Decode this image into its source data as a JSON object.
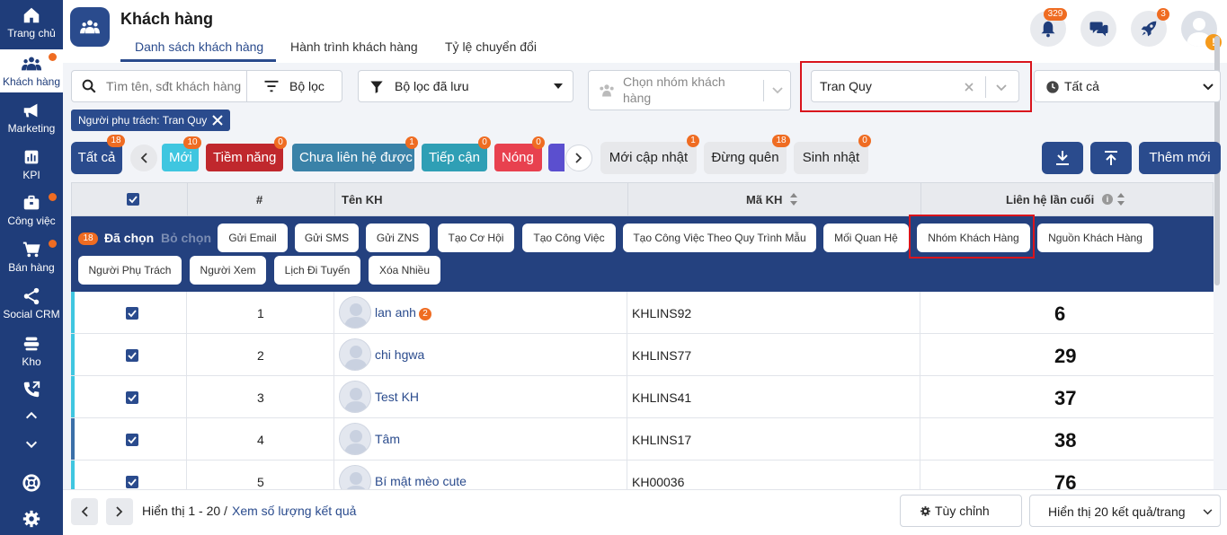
{
  "sidebar": {
    "items": [
      {
        "label": "Trang chủ",
        "icon": "home-icon"
      },
      {
        "label": "Khách hàng",
        "icon": "users-icon"
      },
      {
        "label": "Marketing",
        "icon": "megaphone-icon"
      },
      {
        "label": "KPI",
        "icon": "chart-icon"
      },
      {
        "label": "Công việc",
        "icon": "briefcase-icon"
      },
      {
        "label": "Bán hàng",
        "icon": "cart-icon"
      },
      {
        "label": "Social CRM",
        "icon": "share-icon"
      },
      {
        "label": "Kho",
        "icon": "warehouse-icon"
      }
    ]
  },
  "header": {
    "title": "Khách hàng",
    "tabs": [
      "Danh sách khách hàng",
      "Hành trình khách hàng",
      "Tỷ lệ chuyển đổi"
    ],
    "notif_count": "329",
    "rocket_count": "3"
  },
  "filters": {
    "search_placeholder": "Tìm tên, sđt khách hàng",
    "filter_label": "Bộ lọc",
    "saved_filter_label": "Bộ lọc đã lưu",
    "group_placeholder": "Chọn nhóm khách hàng",
    "owner_value": "Tran Quy",
    "time_value": "Tất cả",
    "active_chip": "Người phụ trách: Tran Quy"
  },
  "status_tags": {
    "all": {
      "label": "Tất cả",
      "count": "18"
    },
    "items": [
      {
        "label": "Mới",
        "count": "10",
        "color": "#3fc6e0"
      },
      {
        "label": "Tiềm năng",
        "count": "0",
        "color": "#c0282d"
      },
      {
        "label": "Chưa liên hệ được",
        "count": "1",
        "color": "#3a82a8"
      },
      {
        "label": "Tiếp cận",
        "count": "0",
        "color": "#2f9fb5"
      },
      {
        "label": "Nóng",
        "count": "0",
        "color": "#e8414f"
      }
    ],
    "extra": [
      {
        "label": "Mới cập nhật",
        "count": "1"
      },
      {
        "label": "Đừng quên",
        "count": "18"
      },
      {
        "label": "Sinh nhật",
        "count": "0"
      }
    ],
    "add_label": "Thêm mới"
  },
  "table": {
    "headers": {
      "index": "#",
      "name": "Tên KH",
      "code": "Mã KH",
      "last_contact": "Liên hệ lần cuối"
    },
    "selected_count": "18",
    "selected_label": "Đã chọn",
    "deselect_label": "Bỏ chọn",
    "actions": [
      "Gửi Email",
      "Gửi SMS",
      "Gửi ZNS",
      "Tạo Cơ Hội",
      "Tạo Công Việc",
      "Tạo Công Việc Theo Quy Trình Mẫu",
      "Mối Quan Hệ",
      "Nhóm Khách Hàng",
      "Nguồn Khách Hàng",
      "Người Phụ Trách",
      "Người Xem",
      "Lịch Đi Tuyến",
      "Xóa Nhiều"
    ],
    "rows": [
      {
        "index": "1",
        "name": "lan anh",
        "badge": "2",
        "code": "KHLINS92",
        "last_contact": "6",
        "stripe": "#3fc6e0"
      },
      {
        "index": "2",
        "name": "chi hgwa",
        "badge": "",
        "code": "KHLINS77",
        "last_contact": "29",
        "stripe": "#3fc6e0"
      },
      {
        "index": "3",
        "name": "Test KH",
        "badge": "",
        "code": "KHLINS41",
        "last_contact": "37",
        "stripe": "#3fc6e0"
      },
      {
        "index": "4",
        "name": "Tâm",
        "badge": "",
        "code": "KHLINS17",
        "last_contact": "38",
        "stripe": "#3a6fa8"
      },
      {
        "index": "5",
        "name": "Bí mật mèo cute",
        "badge": "",
        "code": "KH00036",
        "last_contact": "76",
        "stripe": "#3fc6e0"
      }
    ]
  },
  "footer": {
    "range": "Hiển thị 1 - 20 /",
    "count_link": "Xem số lượng kết quả",
    "customize": "Tùy chỉnh",
    "per_page": "Hiển thị 20 kết quả/trang"
  }
}
